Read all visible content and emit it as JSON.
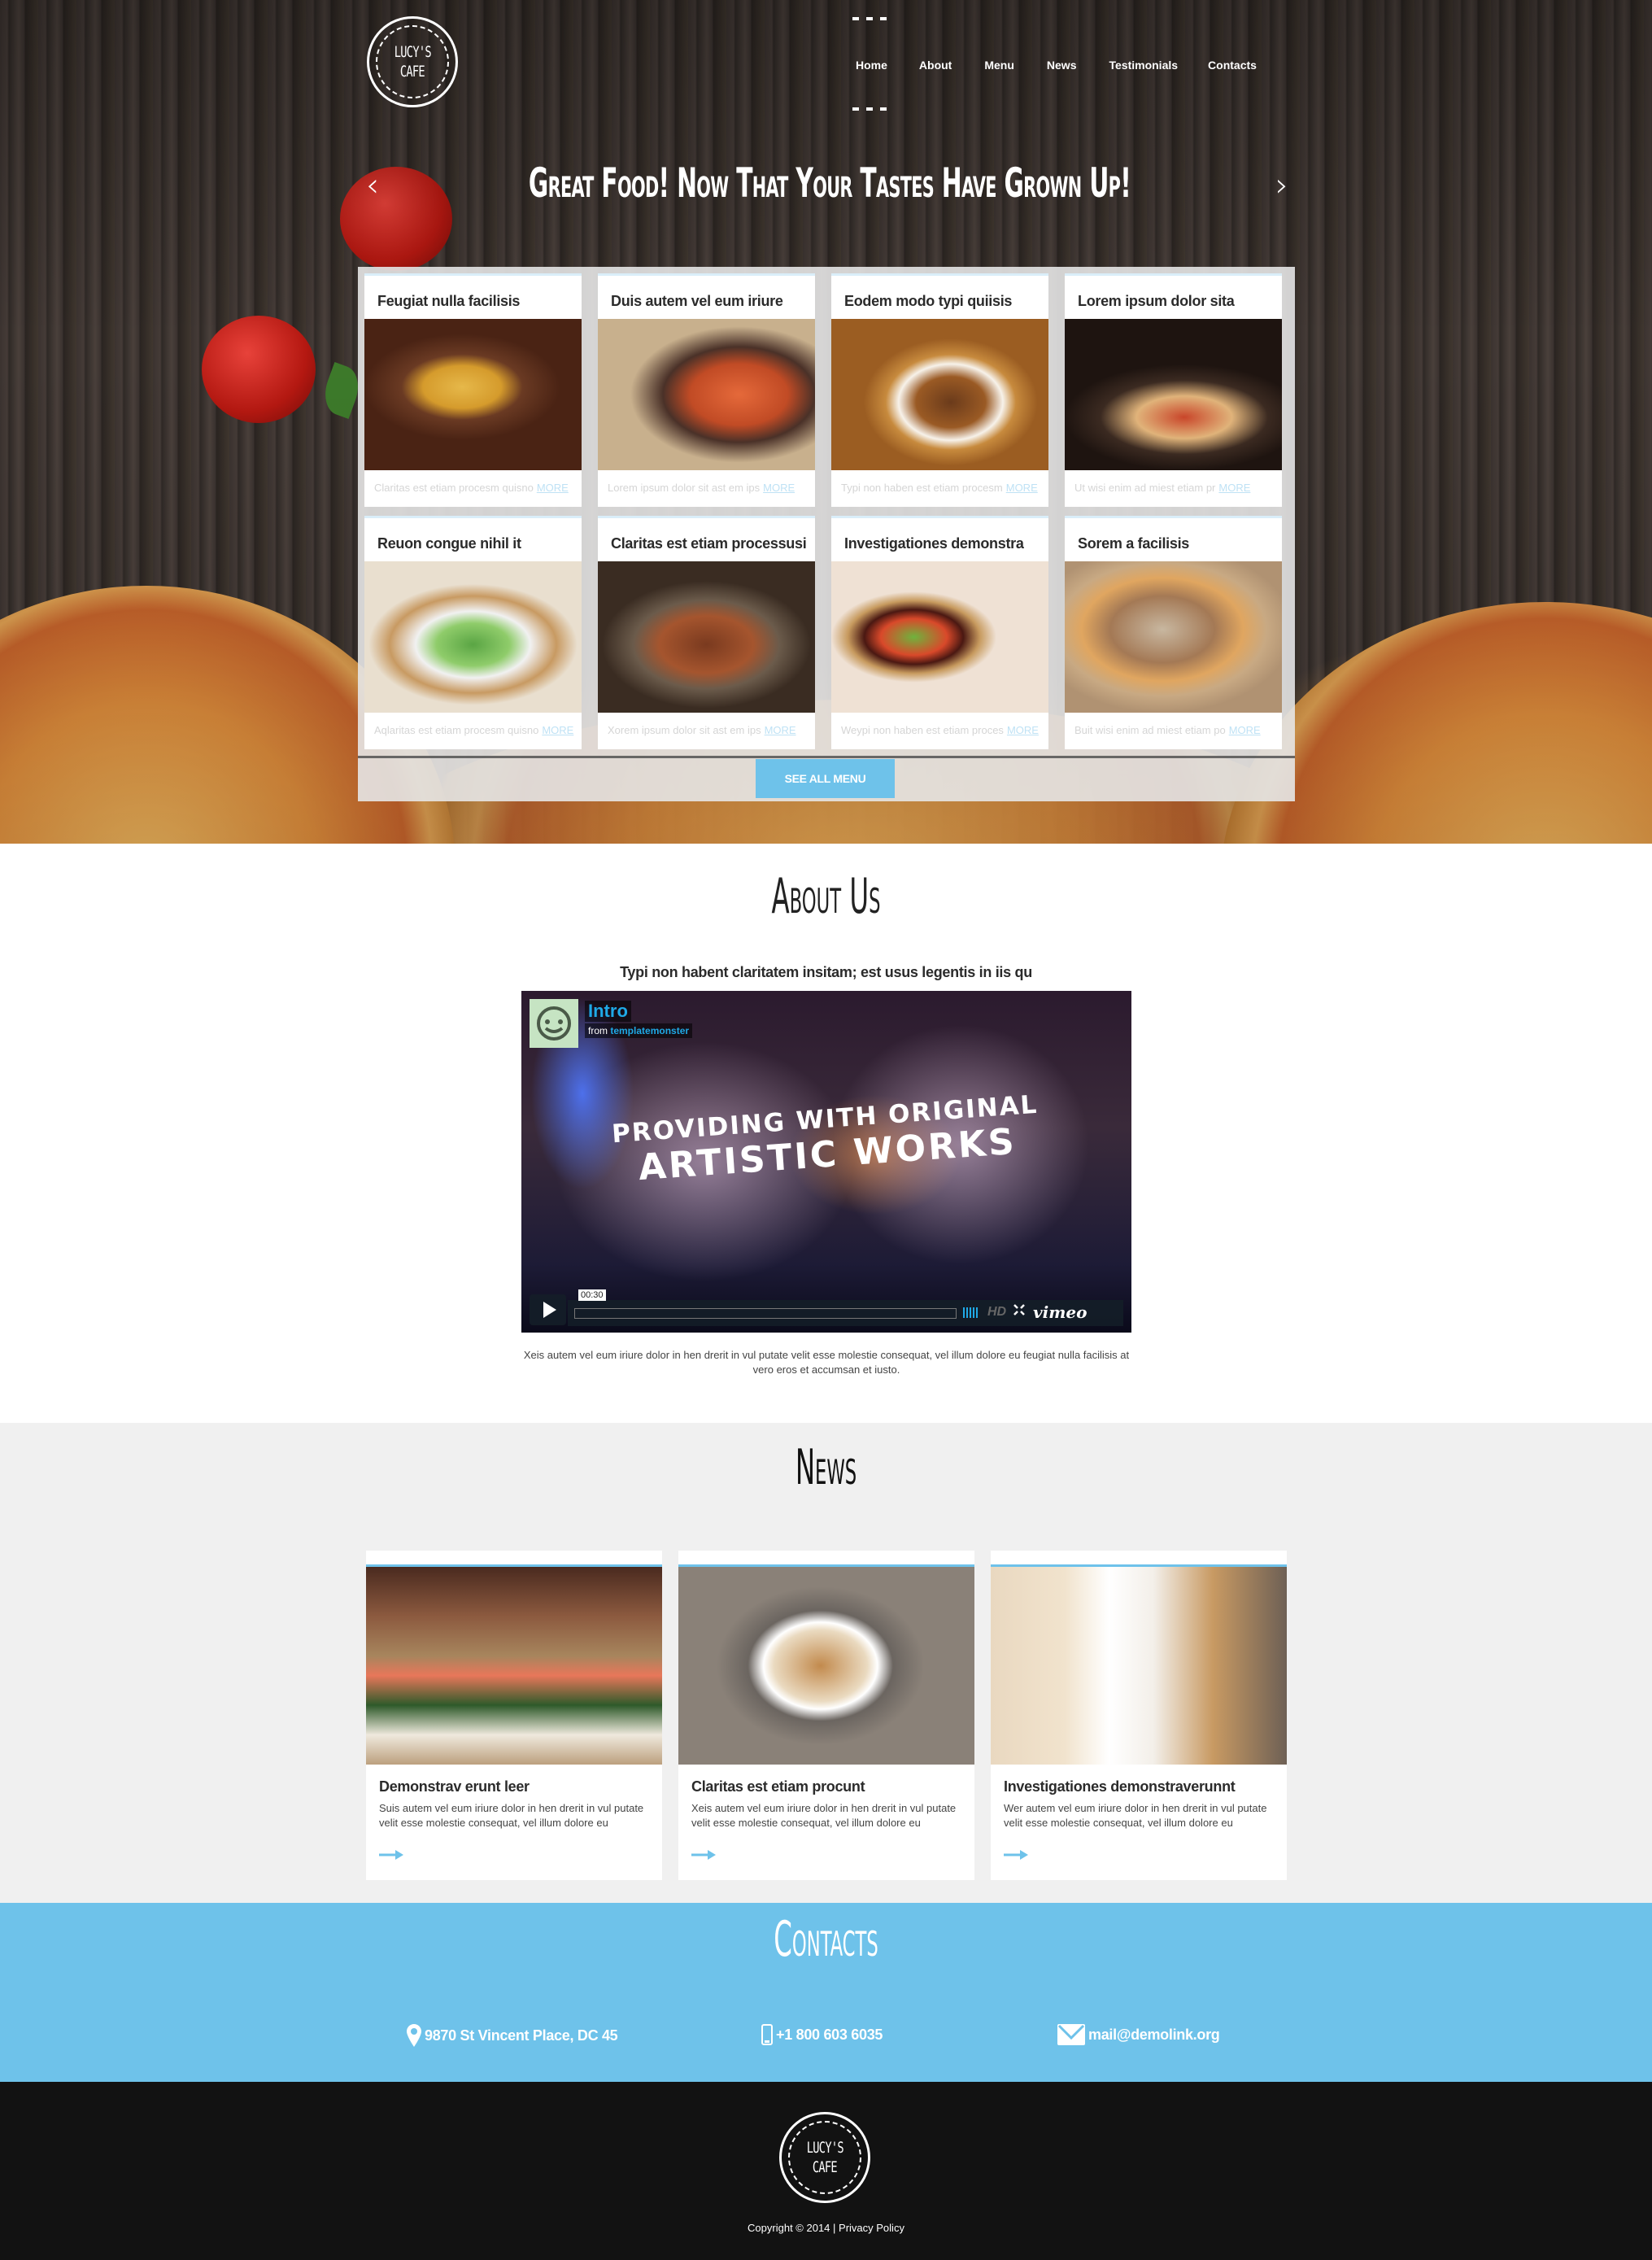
{
  "brand": {
    "logo_line1": "Lucy's",
    "logo_line2": "Cafe"
  },
  "nav": {
    "items": [
      {
        "label": "Home"
      },
      {
        "label": "About"
      },
      {
        "label": "Menu"
      },
      {
        "label": "News"
      },
      {
        "label": "Testimonials"
      },
      {
        "label": "Contacts"
      }
    ]
  },
  "hero": {
    "slogan": "Great Food! Now That Your Tastes Have Grown Up!",
    "prev_icon": "chevron-left-icon",
    "next_icon": "chevron-right-icon",
    "prev_glyph": "‹",
    "next_glyph": "›"
  },
  "menu": {
    "more_label": "MORE",
    "see_all_label": "SEE ALL MENU",
    "items": [
      {
        "title": "Feugiat nulla facilisis",
        "photo": "rice-pilaf-with-peas",
        "text": "Claritas est etiam procesm quisno"
      },
      {
        "title": "Duis autem vel eum iriure",
        "photo": "chicken-curry",
        "text": "Lorem ipsum dolor sit ast em ips"
      },
      {
        "title": "Eodem modo typi quiisis",
        "photo": "beef-stew-bowl",
        "text": "Typi non haben est etiam procesm"
      },
      {
        "title": "Lorem ipsum dolor sita",
        "photo": "flatbread-pizza",
        "text": "Ut wisi enim ad miest etiam pr"
      },
      {
        "title": "Reuon congue nihil it",
        "photo": "greek-salad",
        "text": "Aqlaritas est etiam procesm quisno"
      },
      {
        "title": "Claritas est etiam processusi",
        "photo": "grilled-steak",
        "text": "Xorem ipsum dolor sit ast em ips"
      },
      {
        "title": "Investigationes demonstra",
        "photo": "asian-stir-fry-bowl",
        "text": "Weypi non haben est etiam proces"
      },
      {
        "title": "Sorem a facilisis",
        "photo": "sausage-pizza",
        "text": "Buit wisi enim ad miest etiam po"
      }
    ]
  },
  "about": {
    "title": "About Us",
    "lead": "Typi non habent claritatem insitam; est usus legentis in iis qu",
    "video": {
      "title": "Intro",
      "from_label": "from",
      "author": "templatemonster",
      "headline_line1": "PROVIDING WITH ORIGINAL",
      "headline_line2": "ARTISTIC WORKS",
      "time": "00:30",
      "progress": 0,
      "hd_label": "HD",
      "fullscreen_glyph": "⛶",
      "brand": "vimeo"
    },
    "text": "Xeis autem vel eum iriure dolor in hen drerit in vul putate velit esse molestie consequat, vel illum dolore eu feugiat nulla facilisis at vero eros et accumsan et iusto."
  },
  "news": {
    "title": "News",
    "items": [
      {
        "title": "Demonstrav erunt leer",
        "photo": "sushi-plate",
        "text": "Suis autem vel eum iriure dolor in hen drerit in vul putate velit esse molestie consequat, vel illum dolore eu"
      },
      {
        "title": "Claritas est etiam procunt",
        "photo": "spring-rolls",
        "text": "Xeis autem vel eum iriure dolor in hen drerit in vul putate velit esse molestie consequat, vel illum dolore eu"
      },
      {
        "title": "Investigationes demonstraverunnt",
        "photo": "waitress",
        "text": "Wer autem vel eum iriure dolor in hen drerit in vul putate velit esse molestie consequat, vel illum dolore eu"
      }
    ]
  },
  "contacts": {
    "title": "Contacts",
    "address": "9870 St Vincent Place, DC 45",
    "phone": "+1 800 603 6035",
    "email": "mail@demolink.org"
  },
  "footer": {
    "copyright": "Copyright © 2014 |",
    "privacy": "Privacy Policy"
  },
  "colors": {
    "accent": "#6ec2ea",
    "footer_bg": "#121212",
    "news_bg": "#f0f0f0",
    "video_link": "#1fa9e6"
  }
}
